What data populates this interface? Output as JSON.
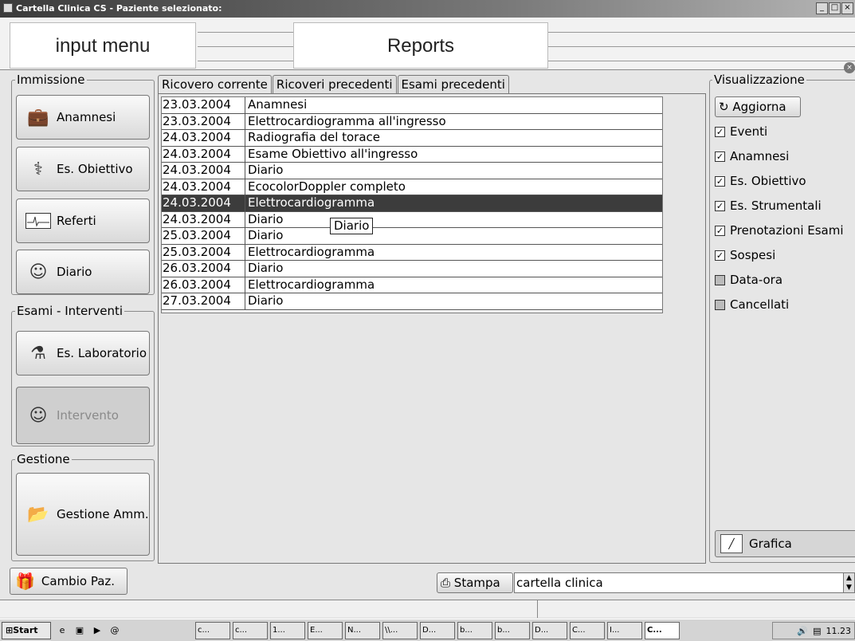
{
  "window": {
    "title": "Cartella Clinica CS - Paziente selezionato:",
    "controls": [
      "_",
      "□",
      "×"
    ]
  },
  "callouts": {
    "input_menu": "input  menu",
    "reports": "Reports"
  },
  "left": {
    "immissione_title": "Immissione",
    "anamnesi": "Anamnesi",
    "es_obiettivo": "Es. Obiettivo",
    "referti": "Referti",
    "diario": "Diario",
    "esami_title": "Esami - Interventi",
    "es_laboratorio": "Es. Laboratorio",
    "intervento": "Intervento",
    "gestione_title": "Gestione",
    "gestione_amm": "Gestione Amm."
  },
  "tabs": [
    "Ricovero corrente",
    "Ricoveri precedenti",
    "Esami precedenti"
  ],
  "events": [
    {
      "date": "23.03.2004",
      "label": "Anamnesi"
    },
    {
      "date": "23.03.2004",
      "label": "Elettrocardiogramma all'ingresso"
    },
    {
      "date": "24.03.2004",
      "label": "Radiografia del torace"
    },
    {
      "date": "24.03.2004",
      "label": "Esame Obiettivo all'ingresso"
    },
    {
      "date": "24.03.2004",
      "label": "Diario"
    },
    {
      "date": "24.03.2004",
      "label": "EcocolorDoppler completo"
    },
    {
      "date": "24.03.2004",
      "label": "Elettrocardiogramma"
    },
    {
      "date": "24.03.2004",
      "label": "Diario"
    },
    {
      "date": "25.03.2004",
      "label": "Diario"
    },
    {
      "date": "25.03.2004",
      "label": "Elettrocardiogramma"
    },
    {
      "date": "26.03.2004",
      "label": "Diario"
    },
    {
      "date": "26.03.2004",
      "label": "Elettrocardiogramma"
    },
    {
      "date": "27.03.2004",
      "label": "Diario"
    }
  ],
  "selected_row": 6,
  "tooltip": "Diario",
  "right": {
    "title": "Visualizzazione",
    "aggiorna": "Aggiorna",
    "checks": [
      {
        "label": "Eventi",
        "checked": true
      },
      {
        "label": "Anamnesi",
        "checked": true
      },
      {
        "label": "Es. Obiettivo",
        "checked": true
      },
      {
        "label": "Es. Strumentali",
        "checked": true
      },
      {
        "label": "Prenotazioni Esami",
        "checked": true
      },
      {
        "label": "Sospesi",
        "checked": true
      },
      {
        "label": "Data-ora",
        "checked": false
      },
      {
        "label": "Cancellati",
        "checked": false
      }
    ],
    "grafica": "Grafica"
  },
  "bottom": {
    "cambio_paz": "Cambio Paz.",
    "stampa": "Stampa",
    "stampa_select": "cartella clinica"
  },
  "taskbar": {
    "start": "Start",
    "items": [
      "c...",
      "c...",
      "1...",
      "E...",
      "N...",
      "\\\\...",
      "D...",
      "b...",
      "b...",
      "D...",
      "C...",
      "I...",
      "C..."
    ],
    "clock": "11.23"
  }
}
